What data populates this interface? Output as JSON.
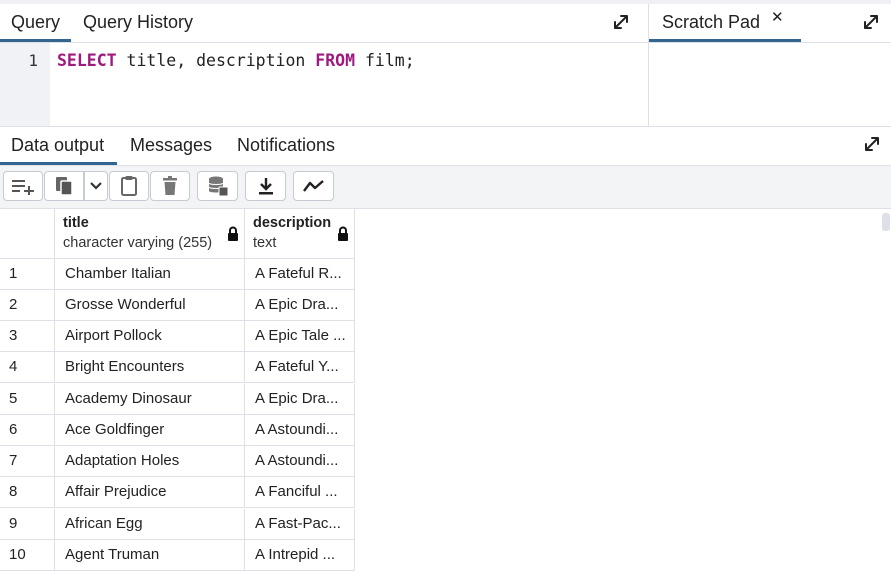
{
  "query_panel": {
    "tabs": [
      {
        "label": "Query"
      },
      {
        "label": "Query History"
      }
    ],
    "editor": {
      "line_number": "1",
      "tokens": {
        "select": "SELECT",
        "columns": " title, description ",
        "from": "FROM",
        "table": " film;"
      }
    }
  },
  "scratch_panel": {
    "tab_label": "Scratch Pad",
    "close_glyph": "✕"
  },
  "output_panel": {
    "tabs": [
      {
        "label": "Data output"
      },
      {
        "label": "Messages"
      },
      {
        "label": "Notifications"
      }
    ],
    "toolbar_icons": [
      "add-row-icon",
      "copy-icon",
      "chevron-down-icon",
      "paste-icon",
      "delete-icon",
      "save-data-icon",
      "download-icon",
      "graph-icon"
    ],
    "columns": [
      {
        "name": "title",
        "type": "character varying (255)"
      },
      {
        "name": "description",
        "type": "text"
      }
    ],
    "rows": [
      {
        "num": "1",
        "title": "Chamber Italian",
        "description": "A Fateful R..."
      },
      {
        "num": "2",
        "title": "Grosse Wonderful",
        "description": "A Epic Dra..."
      },
      {
        "num": "3",
        "title": "Airport Pollock",
        "description": "A Epic Tale ..."
      },
      {
        "num": "4",
        "title": "Bright Encounters",
        "description": "A Fateful Y..."
      },
      {
        "num": "5",
        "title": "Academy Dinosaur",
        "description": "A Epic Dra..."
      },
      {
        "num": "6",
        "title": "Ace Goldfinger",
        "description": "A Astoundi..."
      },
      {
        "num": "7",
        "title": "Adaptation Holes",
        "description": "A Astoundi..."
      },
      {
        "num": "8",
        "title": "Affair Prejudice",
        "description": "A Fanciful ..."
      },
      {
        "num": "9",
        "title": "African Egg",
        "description": "A Fast-Pac..."
      },
      {
        "num": "10",
        "title": "Agent Truman",
        "description": "A Intrepid ..."
      }
    ]
  },
  "colors": {
    "accent_tab_underline": "#326690",
    "sql_keyword": "#a0197f",
    "gutter_bg": "#f0f2f5",
    "border": "#dde0e6"
  }
}
